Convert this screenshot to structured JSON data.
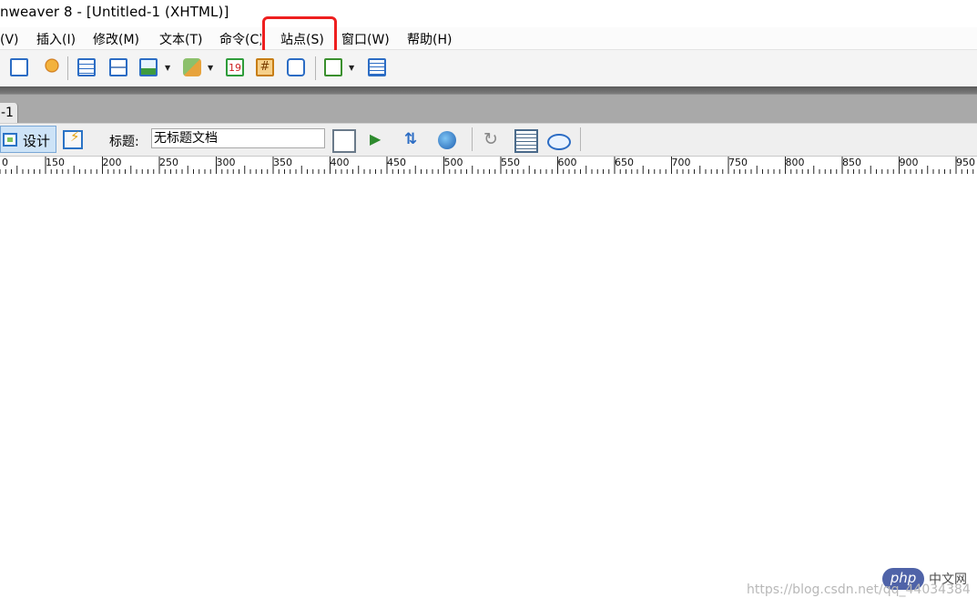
{
  "window": {
    "title": "nweaver 8 - [Untitled-1 (XHTML)]"
  },
  "menu": [
    {
      "label": "看(V)",
      "key": "view"
    },
    {
      "label": "插入(I)",
      "key": "insert"
    },
    {
      "label": "修改(M)",
      "key": "modify"
    },
    {
      "label": "文本(T)",
      "key": "text"
    },
    {
      "label": "命令(C)",
      "key": "commands"
    },
    {
      "label": "站点(S)",
      "key": "site"
    },
    {
      "label": "窗口(W)",
      "key": "window"
    },
    {
      "label": "帮助(H)",
      "key": "help"
    }
  ],
  "highlighted_menu": "站点(S)",
  "toolbar": {
    "icons": [
      "email-link-icon",
      "named-anchor-icon",
      "table-icon",
      "layer-icon",
      "image-icon",
      "media-icon",
      "date-icon",
      "comment-icon",
      "tag-chooser-icon",
      "templates-icon",
      "tag-library-icon"
    ]
  },
  "document_tab": {
    "label": "-1"
  },
  "doc_toolbar": {
    "design_label": "设计",
    "title_label": "标题:",
    "title_value": "无标题文档"
  },
  "ruler": {
    "labels": [
      "0",
      "150",
      "200",
      "250",
      "300",
      "350",
      "400",
      "450",
      "500",
      "550",
      "600",
      "650",
      "700",
      "750",
      "800",
      "850",
      "900",
      "950"
    ]
  },
  "watermark": {
    "badge": "php",
    "brand": "中文网",
    "url": "https://blog.csdn.net/qq_44034384"
  },
  "colors": {
    "highlight": "#ee1f1f",
    "badge": "#4f63a8"
  }
}
